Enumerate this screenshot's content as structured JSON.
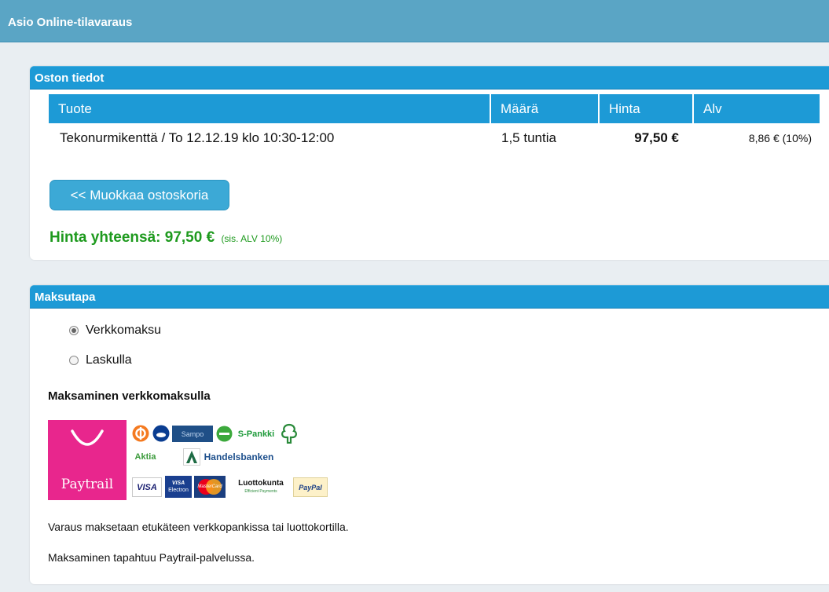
{
  "app": {
    "title": "Asio Online-tilavaraus"
  },
  "purchase": {
    "title": "Oston tiedot",
    "columns": {
      "product": "Tuote",
      "quantity": "Määrä",
      "price": "Hinta",
      "vat": "Alv"
    },
    "rows": [
      {
        "product": "Tekonurmikenttä / To 12.12.19 klo 10:30-12:00",
        "quantity": "1,5 tuntia",
        "price": "97,50 €",
        "vat": "8,86 € (10%)"
      }
    ],
    "edit_cart_label": "<< Muokkaa ostoskoria",
    "total_label": "Hinta yhteensä: 97,50 €",
    "total_note": "(sis. ALV 10%)"
  },
  "payment": {
    "title": "Maksutapa",
    "options": [
      {
        "label": "Verkkomaksu",
        "selected": true
      },
      {
        "label": "Laskulla",
        "selected": false
      }
    ],
    "heading": "Maksaminen verkkomaksulla",
    "provider": "Paytrail",
    "logos": {
      "sampo": "Sampo",
      "spankki": "S-Pankki",
      "aktia": "Aktia",
      "handelsbanken": "Handelsbanken",
      "visa": "VISA",
      "visa_electron_top": "VISA",
      "visa_electron_bottom": "Electron",
      "mastercard": "MasterCard",
      "luottokunta": "Luottokunta",
      "luottokunta_sub": "Efficient Payments",
      "paypal": "PayPal"
    },
    "info": [
      "Varaus maksetaan etukäteen verkkopankissa tai luottokortilla.",
      "Maksaminen tapahtuu Paytrail-palvelussa."
    ]
  },
  "colors": {
    "header_bg": "#5aa5c5",
    "panel_header_bg": "#1d9ad6",
    "total_green": "#1e9a1e",
    "paytrail_pink": "#e8268d"
  }
}
